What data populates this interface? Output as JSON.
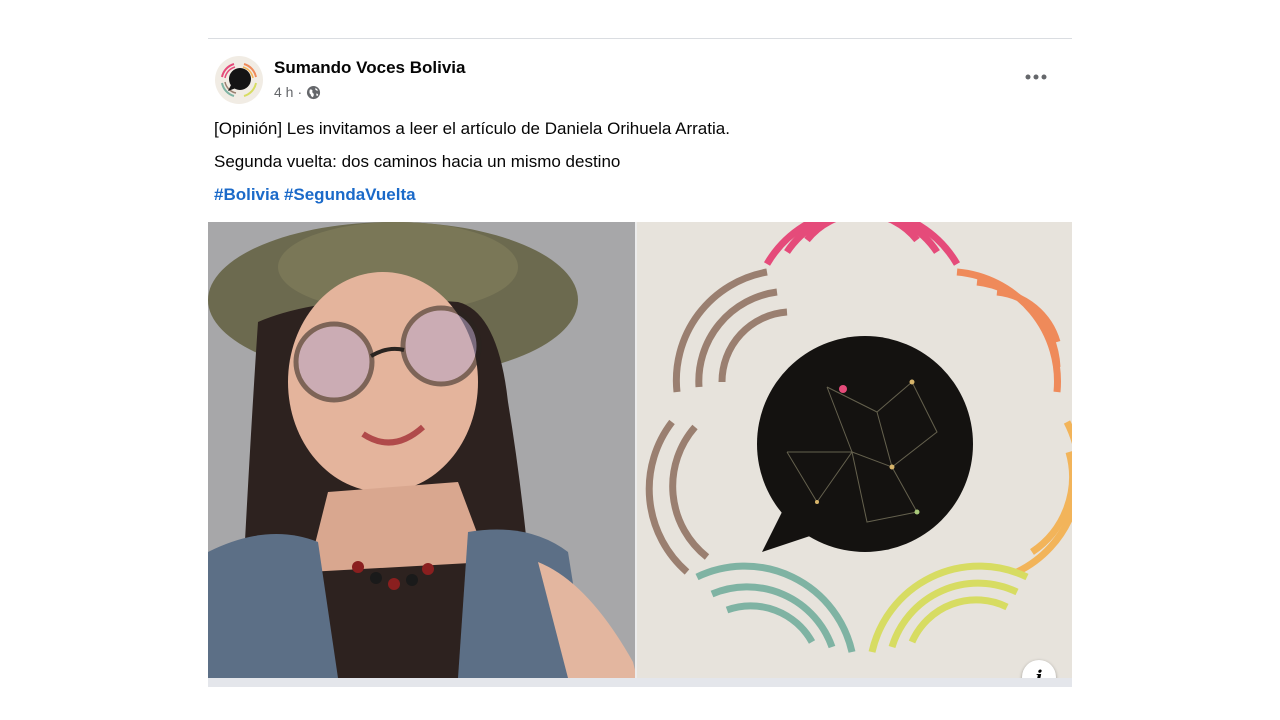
{
  "post": {
    "page_name": "Sumando Voces Bolivia",
    "time": "4 h",
    "separator": "·",
    "privacy_icon": "globe-icon",
    "more_icon": "more-options-icon",
    "line1": "[Opinión] Les invitamos a leer el artículo de Daniela Orihuela Arratia.",
    "line2": "Segunda vuelta: dos caminos hacia un mismo destino",
    "hashtags": [
      "#Bolivia",
      "#SegundaVuelta"
    ]
  },
  "media": {
    "left": "author-portrait-photo",
    "right": "sumando-voces-logo",
    "info_icon": "info-icon",
    "info_label": "i"
  },
  "colors": {
    "link": "#1b6ac9",
    "meta": "#65676b",
    "ring_pink": "#e54b7a",
    "ring_orange": "#ef8a5a",
    "ring_yellow": "#f2b45a",
    "ring_lime": "#d7dc62",
    "ring_teal": "#7fb3a3",
    "ring_brown": "#9a7f70"
  }
}
